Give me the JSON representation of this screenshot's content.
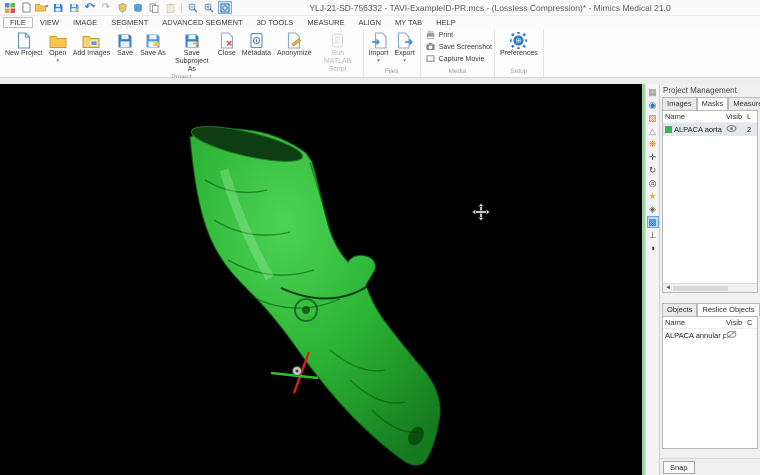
{
  "window": {
    "title": "YLJ-21-SD-756332 - TAVI-ExampleID-PR.mcs -  (Lossless Compression)* - Mimics Medical 21.0"
  },
  "quick_access": {
    "undo_glyph": "↶",
    "redo_glyph": "↷"
  },
  "menu": {
    "items": [
      "FILE",
      "VIEW",
      "IMAGE",
      "SEGMENT",
      "ADVANCED SEGMENT",
      "3D TOOLS",
      "MEASURE",
      "ALIGN",
      "MY TAB",
      "HELP"
    ],
    "active_item": "FILE"
  },
  "ribbon": {
    "groups": [
      {
        "label": "Project",
        "items": [
          {
            "label": "New Project"
          },
          {
            "label": "Open"
          },
          {
            "label": "Add Images"
          },
          {
            "label": "Save"
          },
          {
            "label": "Save As"
          },
          {
            "label": "Save Subproject As"
          },
          {
            "label": "Close"
          },
          {
            "label": "Metadata"
          },
          {
            "label": "Anonymize"
          },
          {
            "label": "Run MATLAB Script",
            "disabled": true
          }
        ]
      },
      {
        "label": "Files",
        "items": [
          {
            "label": "Import"
          },
          {
            "label": "Export"
          }
        ]
      },
      {
        "label": "Media",
        "items": [
          {
            "label": "Print"
          },
          {
            "label": "Save Screenshot"
          },
          {
            "label": "Capture Movie"
          }
        ]
      },
      {
        "label": "Setup",
        "items": [
          {
            "label": "Preferences"
          }
        ]
      }
    ]
  },
  "side_toolbar": {
    "icons": [
      {
        "name": "layout-grid",
        "glyph": "▦"
      },
      {
        "name": "zoom-sphere",
        "glyph": "◉"
      },
      {
        "name": "cube",
        "glyph": "▧"
      },
      {
        "name": "prism",
        "glyph": "△"
      },
      {
        "name": "flower",
        "glyph": "❋"
      },
      {
        "name": "pan",
        "glyph": "✛"
      },
      {
        "name": "rotate",
        "glyph": "↻"
      },
      {
        "name": "orbit",
        "glyph": "◎"
      },
      {
        "name": "splash",
        "glyph": "★"
      },
      {
        "name": "visibility",
        "glyph": "◈"
      },
      {
        "name": "colored-grid",
        "glyph": "▩"
      },
      {
        "name": "axis",
        "glyph": "⊥"
      },
      {
        "name": "contrast",
        "glyph": "◑"
      }
    ],
    "active_icon": "colored-grid"
  },
  "viewport": {
    "model_name": "ALPACA aorta 3D segmentation",
    "model_color": "#2fb73a",
    "crosshair": {
      "x_color": "#e02020",
      "y_color": "#28c428"
    }
  },
  "panel": {
    "title": "Project Management",
    "upper_tabs": [
      "Images",
      "Masks",
      "Measurements"
    ],
    "upper_active_tab": "Masks",
    "masks_table": {
      "columns": [
        "Name",
        "Visib",
        "L"
      ],
      "rows": [
        {
          "name": "ALPACA aorta",
          "swatch_color": "#33b552",
          "visible": true,
          "value": "2"
        }
      ]
    },
    "lower_tabs": [
      "Objects",
      "Reslice Objects"
    ],
    "lower_active_tab": "Reslice Objects",
    "objects_table": {
      "columns": [
        "Name",
        "Visib",
        "C"
      ],
      "rows": [
        {
          "name": "ALPACA annular pla...",
          "visible": false
        }
      ]
    },
    "snap_label": "Snap"
  }
}
